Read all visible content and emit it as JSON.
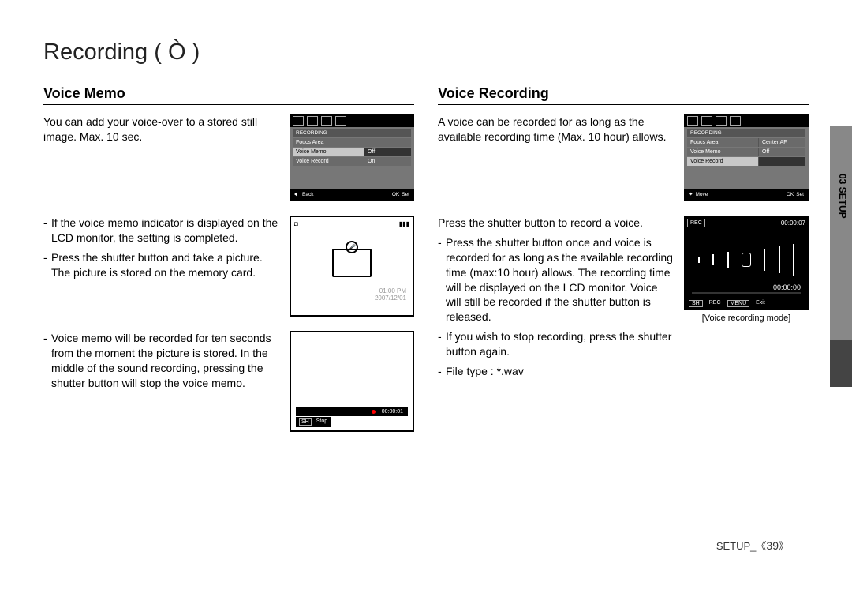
{
  "page_title": "Recording (  Ò  )",
  "side_tab": "03 SETUP",
  "footer": {
    "section": "SETUP_",
    "page": "39"
  },
  "left": {
    "heading": "Voice Memo",
    "intro": "You can add your voice-over to a stored still image. Max. 10 sec.",
    "lcd1": {
      "header": "RECORDING",
      "rows": [
        {
          "l": "Foucs Area",
          "r": ""
        },
        {
          "l": "Voice Memo",
          "r": "Off"
        },
        {
          "l": "Voice Record",
          "r": "On"
        }
      ],
      "foot_back": "Back",
      "foot_ok": "OK",
      "foot_set": "Set"
    },
    "block2": {
      "b1": "If the voice memo indicator is displayed on the LCD monitor, the setting is completed.",
      "b2": "Press the shutter button and take a picture. The picture is stored on the memory card.",
      "shot_time": "01:00 PM",
      "shot_date": "2007/12/01"
    },
    "block3": {
      "b1": "Voice memo will be recorded for ten seconds from the moment the picture is stored. In the middle of the sound recording, pressing the shutter button will stop the voice memo.",
      "timer": "00:00:01",
      "sh": "SH",
      "stop": "Stop"
    }
  },
  "right": {
    "heading": "Voice Recording",
    "intro": "A voice can be recorded for as long as the available recording time (Max. 10 hour) allows.",
    "lcd1": {
      "header": "RECORDING",
      "rows": [
        {
          "l": "Foucs Area",
          "r": "Center AF"
        },
        {
          "l": "Voice Memo",
          "r": "Off"
        },
        {
          "l": "Voice Record",
          "r": ""
        }
      ],
      "foot_move": "Move",
      "foot_ok": "OK",
      "foot_set": "Set"
    },
    "press": "Press the shutter button to record a voice.",
    "b1": "Press the shutter button once and voice is recorded for as long as the available recording time (max:10 hour) allows. The recording time will be displayed on the LCD monitor. Voice will still be recorded if the shutter button is released.",
    "b2": "If you wish to stop recording, press the shutter button again.",
    "b3": "File type : *.wav",
    "voicelcd": {
      "elapsed": "00:00:07",
      "remain": "00:00:00",
      "sh": "SH",
      "rec": "REC",
      "menu": "MENU",
      "exit": "Exit",
      "top_rec": "REC"
    },
    "caption": "[Voice recording mode]"
  }
}
